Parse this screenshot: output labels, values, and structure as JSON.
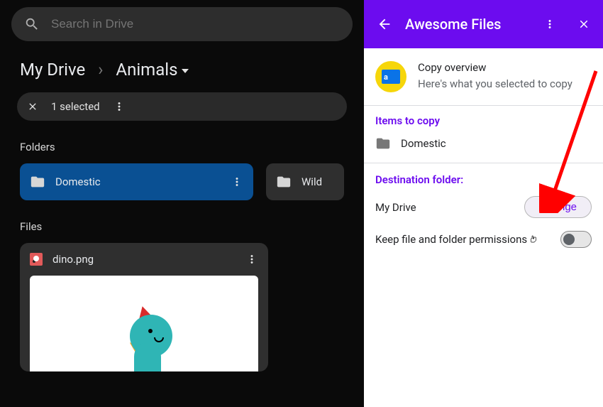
{
  "search": {
    "placeholder": "Search in Drive"
  },
  "breadcrumb": {
    "root": "My Drive",
    "current": "Animals"
  },
  "selection": {
    "count": "1 selected"
  },
  "labels": {
    "folders": "Folders",
    "files": "Files"
  },
  "folders": [
    {
      "name": "Domestic"
    },
    {
      "name": "Wild"
    }
  ],
  "file": {
    "name": "dino.png"
  },
  "panel": {
    "title": "Awesome Files"
  },
  "overview": {
    "title": "Copy overview",
    "subtitle": "Here's what you selected to copy",
    "badge_letter": "a"
  },
  "items_to_copy": {
    "label": "Items to copy",
    "item": "Domestic"
  },
  "destination": {
    "label": "Destination folder:",
    "path": "My Drive",
    "change": "Change",
    "keep": "Keep file and folder permissions"
  }
}
